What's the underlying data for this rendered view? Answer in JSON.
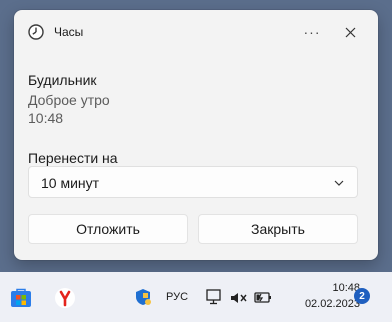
{
  "notification": {
    "app_name": "Часы",
    "more_glyph": "···",
    "title": "Будильник",
    "subtitle": "Доброе утро",
    "time": "10:48",
    "snooze_label": "Перенести на",
    "snooze_value": "10 минут",
    "snooze_button": "Отложить",
    "dismiss_button": "Закрыть"
  },
  "taskbar": {
    "icons": [
      "store-icon",
      "yandex-browser-icon"
    ],
    "tray": {
      "language": "РУС",
      "time": "10:48",
      "date": "02.02.2023",
      "notification_count": "2"
    }
  },
  "colors": {
    "toast_bg": "#f3f3f3",
    "taskbar_bg": "#eef0f6",
    "badge": "#1f5fbf"
  }
}
